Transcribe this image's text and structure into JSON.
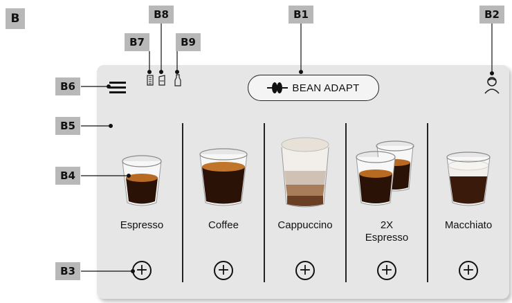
{
  "section_label": "B",
  "callouts": {
    "b1": "B1",
    "b2": "B2",
    "b3": "B3",
    "b4": "B4",
    "b5": "B5",
    "b6": "B6",
    "b7": "B7",
    "b8": "B8",
    "b9": "B9"
  },
  "header": {
    "menu_icon": "hamburger-icon",
    "status_icons": [
      "grinder-icon",
      "water-tank-icon",
      "milk-carafe-icon"
    ],
    "bean_adapt_label": "BEAN ADAPT",
    "profile_icon": "user-profile-icon"
  },
  "drinks": [
    {
      "name": "Espresso",
      "add_icon": "plus-icon"
    },
    {
      "name": "Coffee",
      "add_icon": "plus-icon"
    },
    {
      "name": "Cappuccino",
      "add_icon": "plus-icon"
    },
    {
      "name": "2X\nEspresso",
      "add_icon": "plus-icon"
    },
    {
      "name": "Macchiato",
      "add_icon": "plus-icon"
    }
  ],
  "colors": {
    "screen_bg": "#e6e6e6",
    "tag_bg": "#b8b8b8",
    "coffee": "#2a1206",
    "crema": "#b86a22",
    "milk": "#f2efea"
  }
}
